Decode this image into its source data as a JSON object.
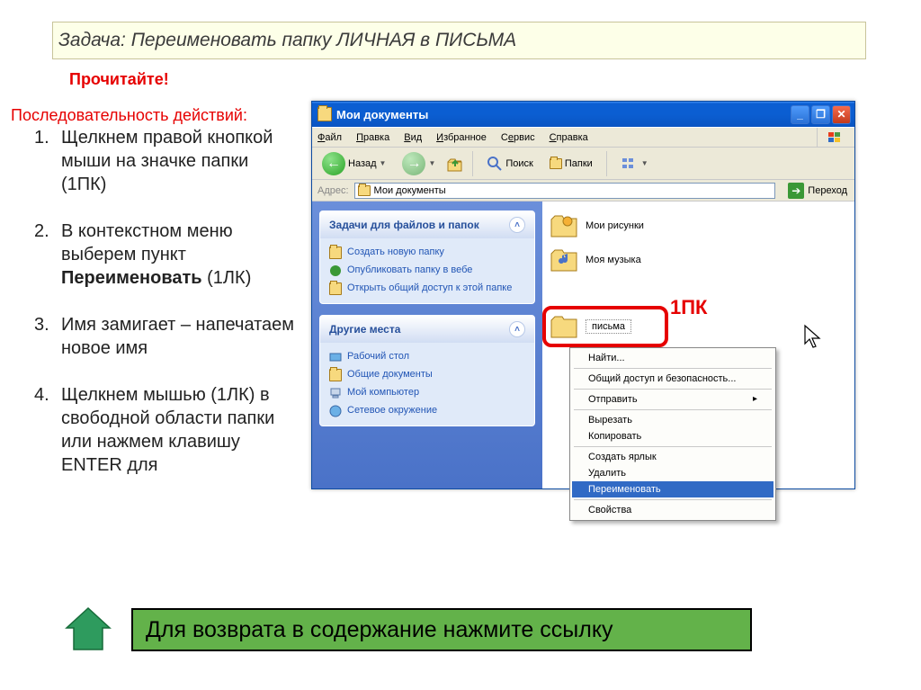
{
  "task_banner": {
    "label": "Задача:",
    "text": "Переименовать папку    ЛИЧНАЯ      в    ПИСЬМА"
  },
  "read_label": "Прочитайте!",
  "sequence_label": "Последовательность действий:",
  "steps": [
    {
      "num": "1",
      "text_before": "Щелкнем правой кнопкой мыши на значке папки (1ПК)"
    },
    {
      "num": "2",
      "text_before": "В контекстном меню выберем пункт ",
      "bold": "Переименовать",
      "text_after": " (1ЛК)"
    },
    {
      "num": "3",
      "text_before": "Имя замигает – напечатаем  новое имя"
    },
    {
      "num": "4",
      "text_before": "Щелкнем мышью (1ЛК) в свободной области папки или нажмем клавишу ENTER для"
    }
  ],
  "return_banner": "Для возврата в содержание нажмите ссылку",
  "window": {
    "title": "Мои документы",
    "menu": {
      "file": "Файл",
      "edit": "Правка",
      "view": "Вид",
      "fav": "Избранное",
      "tools": "Сервис",
      "help": "Справка"
    },
    "toolbar": {
      "back": "Назад",
      "search": "Поиск",
      "folders": "Папки"
    },
    "address": {
      "label": "Адрес:",
      "value": "Мои документы",
      "go": "Переход"
    },
    "sidepanel": {
      "group1": {
        "title": "Задачи для файлов и папок",
        "items": [
          "Создать новую папку",
          "Опубликовать папку в вебе",
          "Открыть общий доступ к этой папке"
        ]
      },
      "group2": {
        "title": "Другие места",
        "items": [
          "Рабочий стол",
          "Общие документы",
          "Мой компьютер",
          "Сетевое окружение"
        ]
      }
    },
    "files": {
      "pictures": "Мои рисунки",
      "music": "Моя музыка",
      "letters": "письма"
    },
    "annot_1pk": "1ПК",
    "context_menu": [
      "Найти...",
      "Общий доступ и безопасность...",
      "Отправить",
      "Вырезать",
      "Копировать",
      "Создать ярлык",
      "Удалить",
      "Переименовать",
      "Свойства"
    ]
  }
}
